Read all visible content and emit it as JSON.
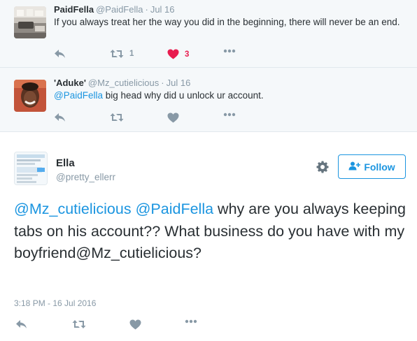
{
  "replies": [
    {
      "name": "PaidFella",
      "handle": "@PaidFella",
      "sep": "·",
      "date": "Jul 16",
      "text_segments": [
        {
          "text": "If you always treat her the way you did in the beginning, there will never be an end.",
          "mention": false
        }
      ],
      "retweet_count": "1",
      "like_count": "3",
      "liked": true
    },
    {
      "name": "'Aduke'",
      "handle": "@Mz_cutielicious",
      "sep": "·",
      "date": "Jul 16",
      "text_segments": [
        {
          "text": "@PaidFella",
          "mention": true
        },
        {
          "text": " big head why did u unlock ur account.",
          "mention": false
        }
      ],
      "retweet_count": "",
      "like_count": "",
      "liked": false
    }
  ],
  "main_tweet": {
    "name": "Ella",
    "handle": "@pretty_ellerr",
    "follow_label": "Follow",
    "text_segments": [
      {
        "text": "@Mz_cutielicious",
        "mention": true
      },
      {
        "text": " ",
        "mention": false
      },
      {
        "text": "@PaidFella",
        "mention": true
      },
      {
        "text": " why are you always keeping tabs on his account??  What business do you have with my boyfriend@Mz_cutielicious?",
        "mention": false
      }
    ],
    "timestamp": "3:18 PM - 16 Jul 2016"
  },
  "icons": {
    "reply": "reply-arrow-icon",
    "retweet": "retweet-icon",
    "like": "heart-icon",
    "more": "more-dots-icon",
    "settings": "gear-icon",
    "follow": "add-user-icon"
  },
  "colors": {
    "link": "#1b95e0",
    "muted": "#8899a6",
    "like": "#e81c4f",
    "text": "#292f33",
    "reply_bg": "#f5f8fa"
  }
}
